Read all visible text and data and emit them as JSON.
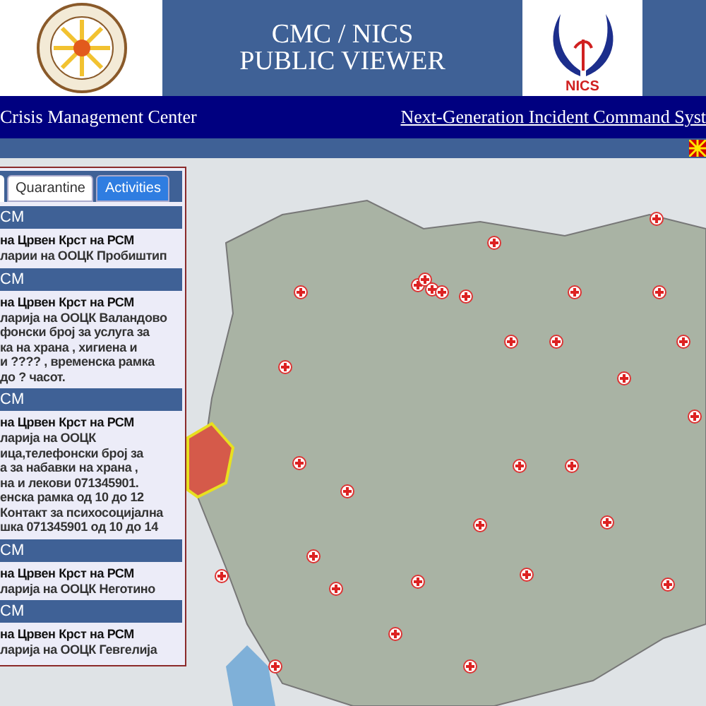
{
  "header": {
    "title_lines": [
      "CMC / NICS",
      "PUBLIC VIEWER"
    ],
    "right_logo_text": "NICS"
  },
  "nav": {
    "left": "Crisis Management Center",
    "right_link": "Next-Generation Incident Command Syst"
  },
  "tabs": [
    {
      "label": "Quarantine",
      "selected": false
    },
    {
      "label": "Activities",
      "selected": true
    }
  ],
  "activities": [
    {
      "heading": "CM",
      "title": "на Црвен Крст на РСМ",
      "lines": [
        "ларии на ООЦК Пробиштип"
      ]
    },
    {
      "heading": "CM",
      "title": "на Црвен Крст на РСМ",
      "lines": [
        "ларија на ООЦК Валандово",
        "фонски број за услуга за",
        "ка на храна , хигиена и",
        "и ???? , временска рамка",
        "до ? часот."
      ]
    },
    {
      "heading": "CM",
      "title": "на Црвен Крст на РСМ",
      "lines": [
        "ларија на ООЦК",
        "ица,телефонски број за",
        "а за набавки на храна ,",
        "на и лекови 071345901.",
        "енска рамка од 10 до 12",
        "Контакт за психосоцијална",
        "шка 071345901 од 10 до 14"
      ]
    },
    {
      "heading": "CM",
      "title": "на Црвен Крст на РСМ",
      "lines": [
        "ларија на ООЦК Неготино"
      ]
    },
    {
      "heading": "CM",
      "title": "на Црвен Крст на РСМ",
      "lines": [
        "ларија на ООЦК Гевгелија"
      ]
    }
  ]
}
